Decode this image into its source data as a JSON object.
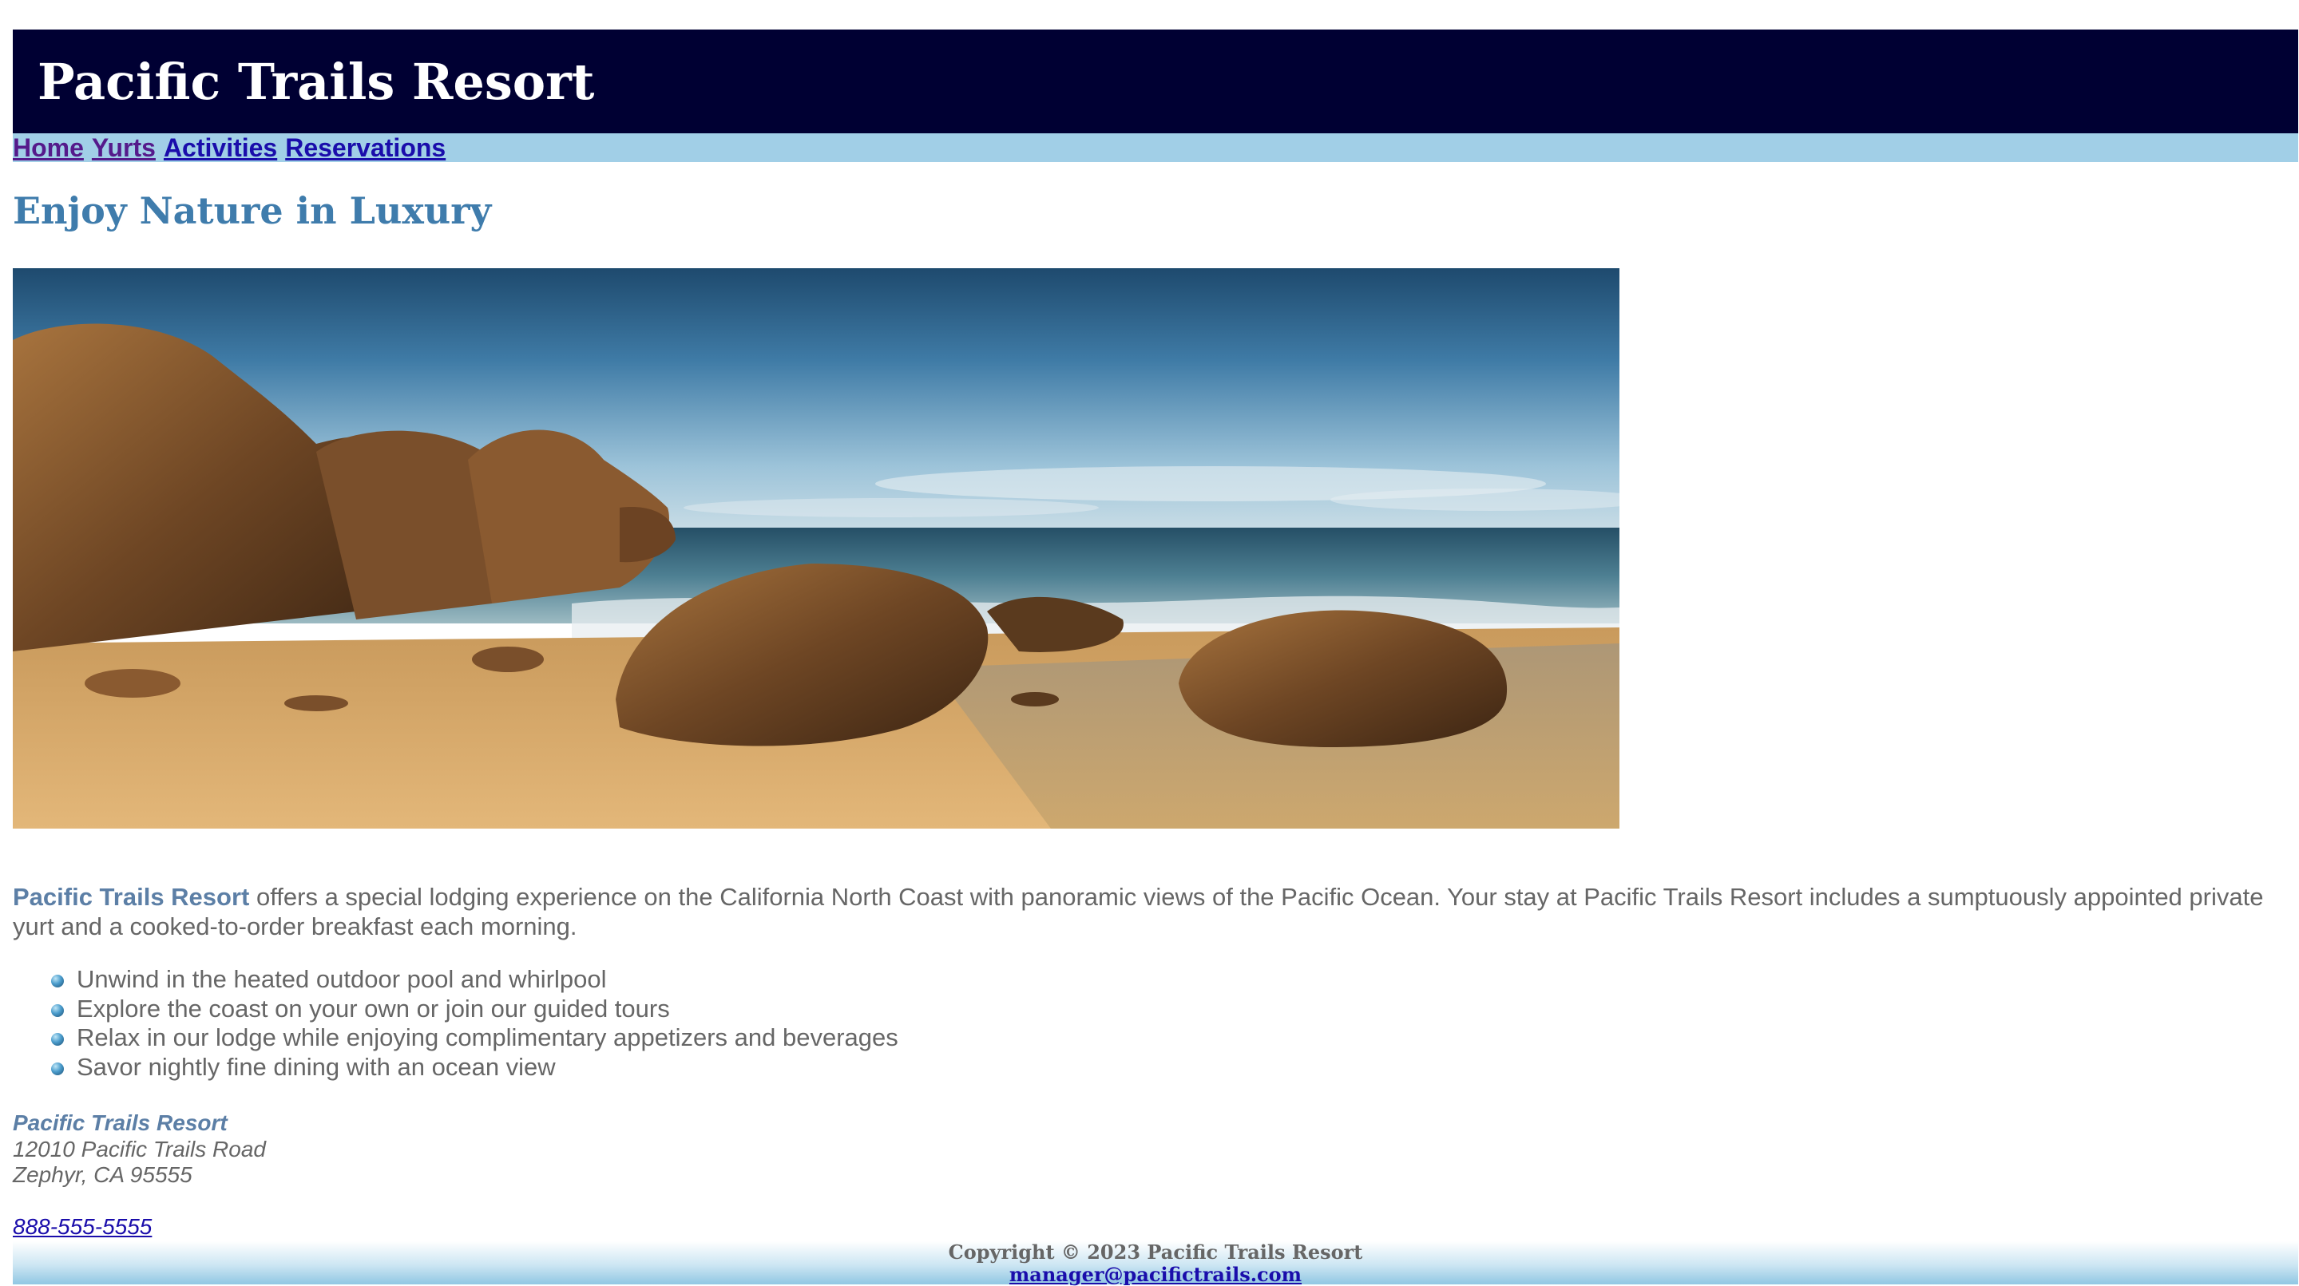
{
  "site": {
    "title": "Pacific Trails Resort"
  },
  "nav": [
    {
      "label": "Home",
      "visited": true
    },
    {
      "label": "Yurts",
      "visited": true
    },
    {
      "label": "Activities",
      "visited": false
    },
    {
      "label": "Reservations",
      "visited": false
    }
  ],
  "main": {
    "heading": "Enjoy Nature in Luxury",
    "intro_brand": "Pacific Trails Resort",
    "intro_text": " offers a special lodging experience on the California North Coast with panoramic views of the Pacific Ocean. Your stay at Pacific Trails Resort includes a sumptuously appointed private yurt and a cooked-to-order breakfast each morning.",
    "features": [
      "Unwind in the heated outdoor pool and whirlpool",
      "Explore the coast on your own or join our guided tours",
      "Relax in our lodge while enjoying complimentary appetizers and beverages",
      "Savor nightly fine dining with an ocean view"
    ]
  },
  "contact": {
    "name": "Pacific Trails Resort",
    "street": "12010 Pacific Trails Road",
    "city": "Zephyr, CA 95555",
    "phone": "888-555-5555"
  },
  "footer": {
    "copyright": "Copyright © 2023 Pacific Trails Resort",
    "email": "manager@pacifictrails.com"
  },
  "colors": {
    "header_bg": "#000033",
    "nav_bg": "#90c7e3",
    "heading": "#3f7cac",
    "brand_text": "#5c7fa6",
    "body_text": "#666666"
  }
}
